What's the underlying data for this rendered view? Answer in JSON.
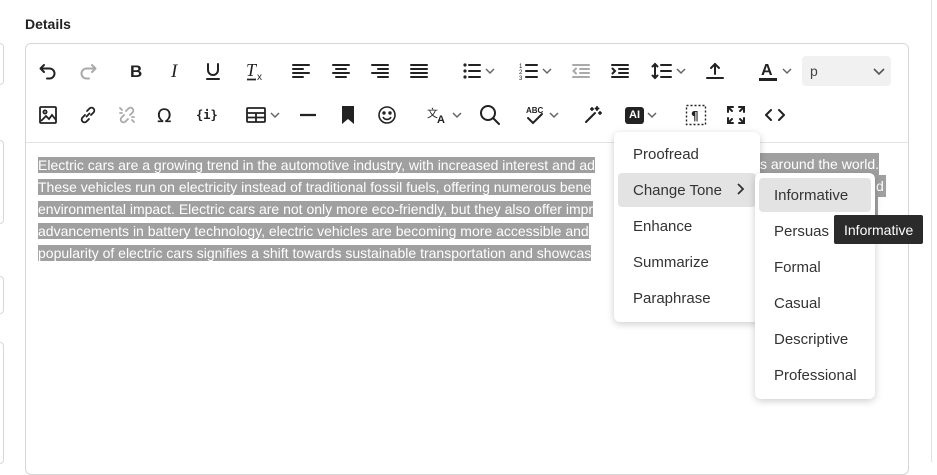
{
  "section": {
    "label": "Details"
  },
  "toolbar": {
    "icons": [
      "undo-icon",
      "redo-icon",
      "bold-icon",
      "italic-icon",
      "underline-icon",
      "clear-formatting-icon",
      "align-left-icon",
      "align-center-icon",
      "align-right-icon",
      "align-justify-icon",
      "bullet-list-icon",
      "numbered-list-icon",
      "outdent-icon",
      "indent-icon",
      "line-height-icon",
      "upload-icon",
      "text-color-icon",
      "image-icon",
      "link-icon",
      "unlink-icon",
      "omega-icon",
      "template-icon",
      "table-icon",
      "horizontal-line-icon",
      "bookmark-icon",
      "emoji-icon",
      "translate-icon",
      "search-icon",
      "spellcheck-icon",
      "magic-wand-icon",
      "ai-icon",
      "show-blocks-icon",
      "fullscreen-icon",
      "code-icon"
    ],
    "format_value": "p",
    "ai_label": "AI"
  },
  "content": {
    "lines": [
      "Electric cars are a growing trend in the automotive industry, with increased interest and ad",
      "These vehicles run on electricity instead of traditional fossil fuels, offering numerous bene",
      "environmental impact. Electric cars are not only more eco-friendly, but they also offer impr",
      "advancements in battery technology, electric vehicles are becoming more accessible and",
      "popularity of electric cars signifies a shift towards sustainable transportation and showcas"
    ],
    "tail1": "s around the world.",
    "tail2": "d"
  },
  "ai_menu": {
    "items": [
      "Proofread",
      "Change Tone",
      "Enhance",
      "Summarize",
      "Paraphrase"
    ]
  },
  "tone_menu": {
    "items": [
      "Informative",
      "Persuas",
      "Formal",
      "Casual",
      "Descriptive",
      "Professional"
    ]
  },
  "tooltip": {
    "text": "Informative"
  },
  "colors": {
    "selection": "#a0a0a0",
    "highlight": "#e3e3e3",
    "tooltip_bg": "#2b2b2b"
  }
}
